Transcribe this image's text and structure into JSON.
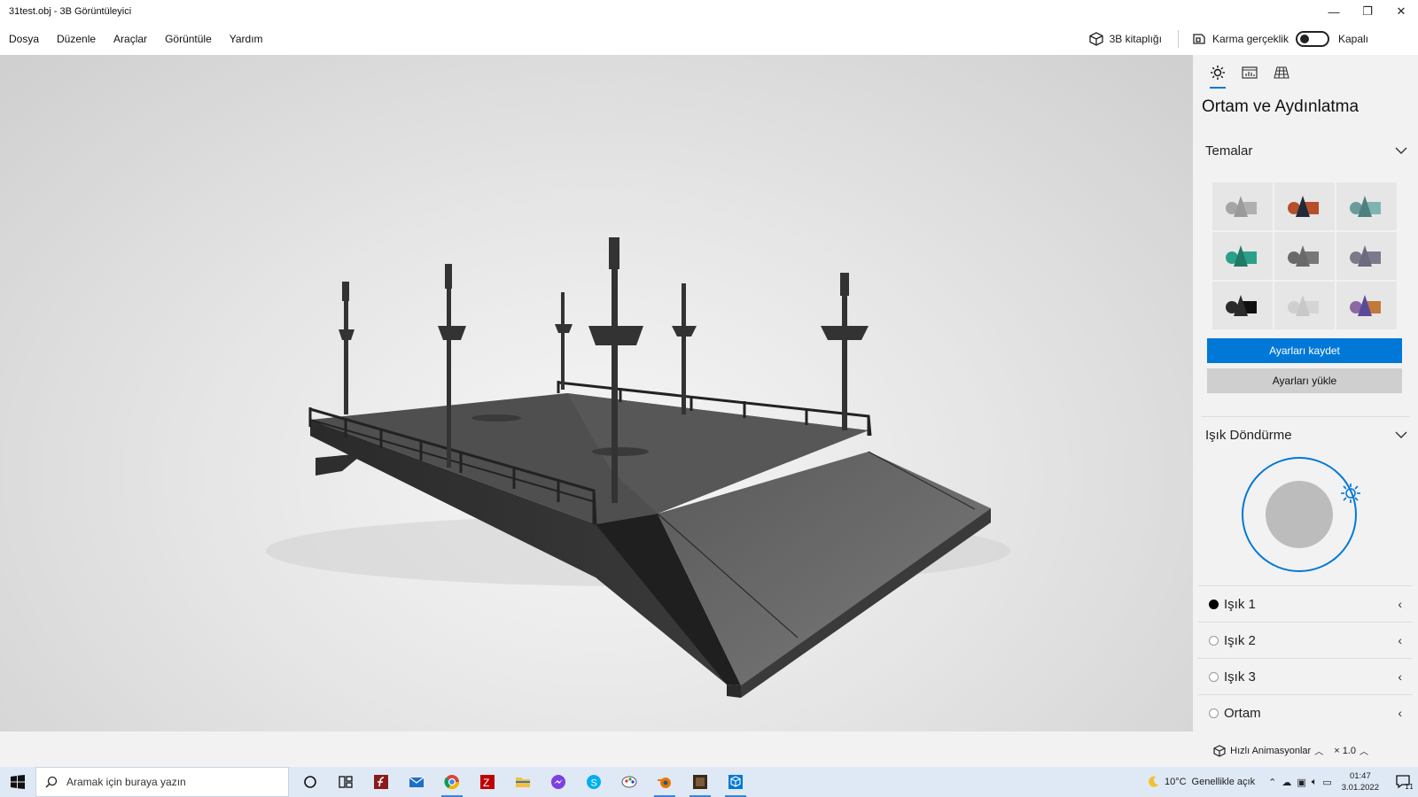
{
  "window": {
    "title": "31test.obj - 3B Görüntüleyici",
    "minimize_glyph": "—",
    "restore_glyph": "❐",
    "close_glyph": "✕"
  },
  "menu": {
    "items": [
      "Dosya",
      "Düzenle",
      "Araçlar",
      "Görüntüle",
      "Yardım"
    ],
    "library_label": "3B kitaplığı",
    "mixed_reality_label": "Karma gerçeklik",
    "toggle_state_label": "Kapalı",
    "toggle_on": false
  },
  "panel": {
    "tabs": [
      "sun-icon",
      "stats-icon",
      "grid-icon"
    ],
    "active_tab": 0,
    "heading": "Ortam ve Aydınlatma",
    "themes_section": "Temalar",
    "themes": [
      {
        "cone": "#9a9a9a",
        "box": "#b0b0b0",
        "sphere": "#a5a5a5"
      },
      {
        "cone": "#222a3a",
        "box": "#b5502a",
        "sphere": "#b5502a"
      },
      {
        "cone": "#4f7f80",
        "box": "#7fb5b0",
        "sphere": "#6a9a9a"
      },
      {
        "cone": "#1f7a66",
        "box": "#2aa08a",
        "sphere": "#2aa08a"
      },
      {
        "cone": "#6a6a6a",
        "box": "#777777",
        "sphere": "#6a6a6a"
      },
      {
        "cone": "#6a6a80",
        "box": "#7a7a8a",
        "sphere": "#7a7a8a"
      },
      {
        "cone": "#2b2b2b",
        "box": "#101010",
        "sphere": "#2b2b2b"
      },
      {
        "cone": "#c8c8c8",
        "box": "#d5d5d5",
        "sphere": "#cfcfcf"
      },
      {
        "cone": "#5a4a9a",
        "box": "#c07a3a",
        "sphere": "#8a6aa0"
      }
    ],
    "save_label": "Ayarları kaydet",
    "load_label": "Ayarları yükle",
    "rotation_section": "Işık Döndürme",
    "lights": [
      {
        "label": "Işık 1",
        "selected": true
      },
      {
        "label": "Işık 2",
        "selected": false
      },
      {
        "label": "Işık 3",
        "selected": false
      },
      {
        "label": "Ortam",
        "selected": false
      }
    ]
  },
  "statusbar": {
    "animations_label": "Hızlı Animasyonlar",
    "speed_label": "× 1.0"
  },
  "taskbar": {
    "search_placeholder": "Aramak için buraya yazın",
    "apps": [
      {
        "icon": "cortana-icon",
        "running": false
      },
      {
        "icon": "task-view-icon",
        "running": false
      },
      {
        "icon": "flash-icon",
        "running": false
      },
      {
        "icon": "mail-icon",
        "running": false
      },
      {
        "icon": "chrome-icon",
        "running": true
      },
      {
        "icon": "filezilla-icon",
        "running": false
      },
      {
        "icon": "file-explorer-icon",
        "running": false
      },
      {
        "icon": "messenger-icon",
        "running": false
      },
      {
        "icon": "skype-icon",
        "running": false
      },
      {
        "icon": "paint-icon",
        "running": false
      },
      {
        "icon": "blender-icon",
        "running": true
      },
      {
        "icon": "game-icon",
        "running": true
      },
      {
        "icon": "3d-viewer-icon",
        "running": true
      }
    ],
    "weather_temp": "10°C",
    "weather_text": "Genellikle açık",
    "time": "01:47",
    "date": "3.01.2022",
    "notification_count": "11"
  },
  "colors": {
    "accent": "#0078d7",
    "taskbar_bg": "#dfe9f5",
    "panel_bg": "#f2f2f2"
  }
}
